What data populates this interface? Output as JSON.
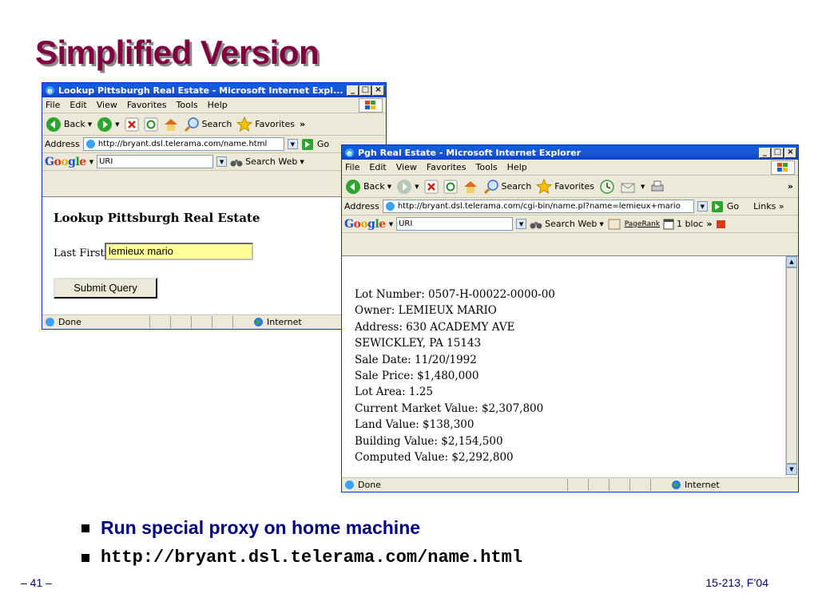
{
  "slide": {
    "title": "Simplified Version",
    "bullets": [
      "Run special proxy on home machine",
      "http://bryant.dsl.telerama.com/name.html"
    ],
    "footer_left": "– 41 –",
    "footer_right": "15-213, F’04"
  },
  "win1": {
    "title": "Lookup Pittsburgh Real Estate - Microsoft Internet Expl...",
    "menu": [
      "File",
      "Edit",
      "View",
      "Favorites",
      "Tools",
      "Help"
    ],
    "toolbar": {
      "back": "Back",
      "search": "Search",
      "favorites": "Favorites",
      "more": "»"
    },
    "address_label": "Address",
    "address_value": "http://bryant.dsl.telerama.com/name.html",
    "go": "Go",
    "google": {
      "combo_value": "URI",
      "search_web": "Search Web"
    },
    "page": {
      "heading": "Lookup Pittsburgh Real Estate",
      "field_label": "Last First",
      "field_value": "lemieux mario",
      "submit": "Submit Query"
    },
    "status": {
      "left": "Done",
      "zone": "Internet"
    }
  },
  "win2": {
    "title": "Pgh Real Estate - Microsoft Internet Explorer",
    "menu": [
      "File",
      "Edit",
      "View",
      "Favorites",
      "Tools",
      "Help"
    ],
    "toolbar": {
      "back": "Back",
      "search": "Search",
      "favorites": "Favorites",
      "more": "»"
    },
    "address_label": "Address",
    "address_value": "http://bryant.dsl.telerama.com/cgi-bin/name.pl?name=lemieux+mario",
    "go": "Go",
    "links": "Links »",
    "google": {
      "combo_value": "URI",
      "search_web": "Search Web",
      "pagerank": "PageRank",
      "blocked": "1 bloc",
      "more": "»"
    },
    "lines": [
      "Lot Number: 0507-H-00022-0000-00",
      "Owner: LEMIEUX MARIO",
      "Address: 630 ACADEMY AVE",
      "SEWICKLEY, PA 15143",
      "Sale Date: 11/20/1992",
      "Sale Price: $1,480,000",
      "Lot Area: 1.25",
      "Current Market Value: $2,307,800",
      "Land Value: $138,300",
      "Building Value: $2,154,500",
      "Computed Value: $2,292,800"
    ],
    "status": {
      "left": "Done",
      "zone": "Internet"
    }
  },
  "colors": {
    "title": "#800040",
    "bullet_text": "#000080",
    "xp_blue": "#0a5be8",
    "highlight_field": "#ffff99"
  }
}
